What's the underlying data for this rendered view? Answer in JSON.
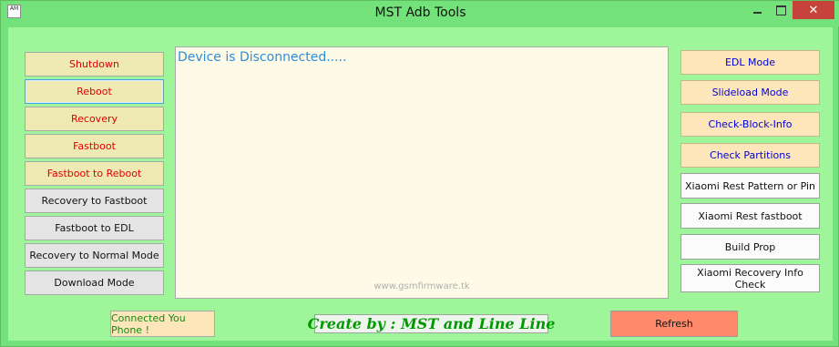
{
  "window": {
    "title": "MST Adb Tools",
    "icon_text": "AM"
  },
  "left_buttons": [
    "Shutdown",
    "Reboot",
    "Recovery",
    "Fastboot",
    "Fastboot to Reboot",
    "Recovery to Fastboot",
    "Fastboot to EDL",
    "Recovery to Normal Mode",
    "Download Mode"
  ],
  "right_buttons": [
    "EDL Mode",
    "Slideload Mode",
    "Check-Block-Info",
    "Check Partitions",
    "Xiaomi Rest Pattern or Pin",
    "Xiaomi Rest fastboot",
    "Build Prop",
    "Xiaomi Recovery Info Check"
  ],
  "console": {
    "status": "Device is Disconnected.....",
    "watermark": "www.gsmfirmware.tk"
  },
  "footer": {
    "connected_label": "Connected You Phone !",
    "credit": "Create by : MST and Line Line",
    "refresh_label": "Refresh"
  }
}
